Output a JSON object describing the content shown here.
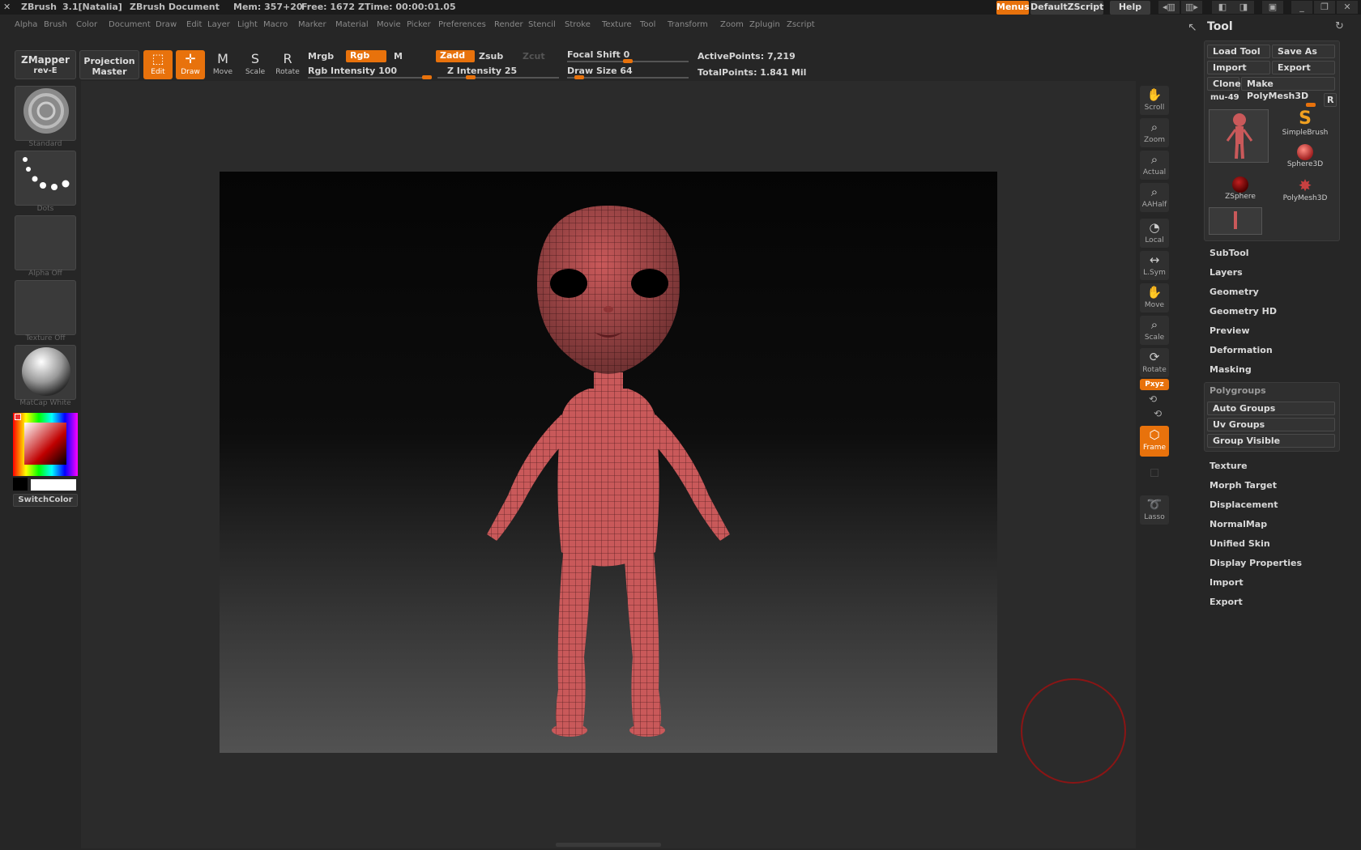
{
  "titlebar": {
    "app": "ZBrush",
    "version": "3.1[Natalia]",
    "document": "ZBrush Document",
    "mem": "Mem: 357+20",
    "free": "Free: 1672",
    "ztime": "ZTime: 00:00:01.05",
    "menus": "Menus",
    "default_script": "DefaultZScript",
    "help": "Help"
  },
  "menubar": [
    "Alpha",
    "Brush",
    "Color",
    "Document",
    "Draw",
    "Edit",
    "Layer",
    "Light",
    "Macro",
    "Marker",
    "Material",
    "Movie",
    "Picker",
    "Preferences",
    "Render",
    "Stencil",
    "Stroke",
    "Texture",
    "Tool",
    "Transform",
    "Zoom",
    "Zplugin",
    "Zscript"
  ],
  "toolbar": {
    "zmapper": "ZMapper",
    "zmapper_sub": "rev-E",
    "projection": "Projection",
    "projection_sub": "Master",
    "edit": "Edit",
    "draw": "Draw",
    "move": "Move",
    "scale": "Scale",
    "rotate": "Rotate",
    "mrgb": "Mrgb",
    "rgb": "Rgb",
    "m": "M",
    "zadd": "Zadd",
    "zsub": "Zsub",
    "zcut": "Zcut",
    "rgb_intensity": "Rgb Intensity 100",
    "z_intensity": "Z Intensity 25",
    "focal_shift": "Focal Shift 0",
    "draw_size": "Draw Size 64",
    "active_points": "ActivePoints: 7,219",
    "total_points": "TotalPoints: 1.841 Mil",
    "rgb_intensity_value": 100,
    "z_intensity_value": 25,
    "focal_shift_value": 0,
    "draw_size_value": 64
  },
  "shelf": {
    "standard": "Standard",
    "dots": "Dots",
    "alpha_off": "Alpha  Off",
    "texture_off": "Texture  Off",
    "matcap": "MatCap White",
    "switch_color": "SwitchColor"
  },
  "right_toolbar": {
    "scroll": "Scroll",
    "zoom": "Zoom",
    "actual": "Actual",
    "aahalf": "AAHalf",
    "local": "Local",
    "lsym": "L.Sym",
    "move": "Move",
    "scale": "Scale",
    "rotate": "Rotate",
    "xyz": "Pxyz",
    "frame": "Frame",
    "lasso": "Lasso"
  },
  "tool_panel": {
    "title": "Tool",
    "load_tool": "Load Tool",
    "save_as": "Save As",
    "import": "Import",
    "export": "Export",
    "clone": "Clone",
    "make_polymesh": "Make PolyMesh3D",
    "mesh_name": "mu-49",
    "r": "R",
    "tools": [
      "SimpleBrush",
      "Sphere3D",
      "ZSphere",
      "PolyMesh3D"
    ],
    "sections": [
      "SubTool",
      "Layers",
      "Geometry",
      "Geometry HD",
      "Preview",
      "Deformation",
      "Masking"
    ],
    "polygroups": "Polygroups",
    "polygroup_buttons": [
      "Auto Groups",
      "Uv Groups",
      "Group Visible"
    ],
    "sections2": [
      "Texture",
      "Morph Target",
      "Displacement",
      "NormalMap",
      "Unified Skin",
      "Display Properties",
      "Import",
      "Export"
    ]
  },
  "colors": {
    "accent": "#e8720c",
    "model": "#c9595a"
  }
}
